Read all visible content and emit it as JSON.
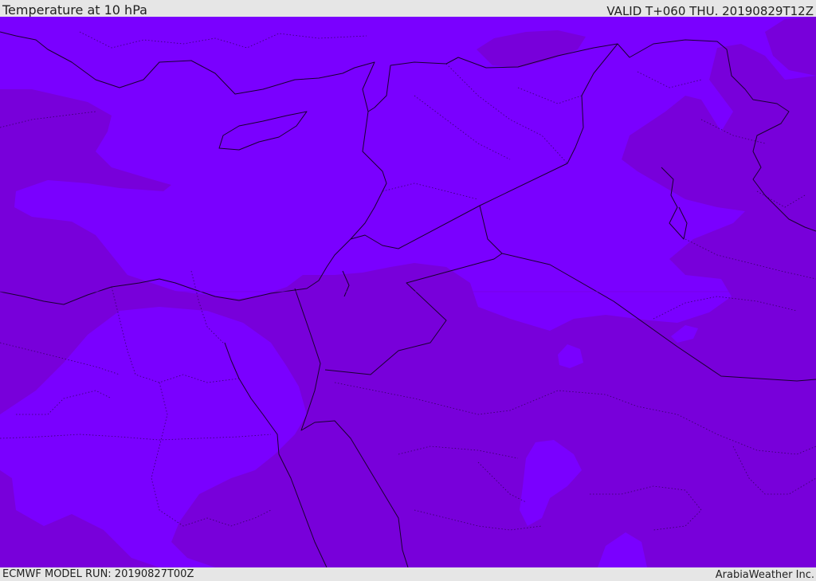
{
  "header": {
    "title": "Temperature at 10 hPa",
    "valid": "VALID T+060 THU. 20190829T12Z"
  },
  "footer": {
    "model_run": "ECMWF MODEL RUN: 20190827T00Z",
    "credit": "ArabiaWeather Inc."
  },
  "map": {
    "colors": {
      "shade_warm": "#7a00ff",
      "shade_cool": "#7800da",
      "border": "#1a0030"
    }
  }
}
